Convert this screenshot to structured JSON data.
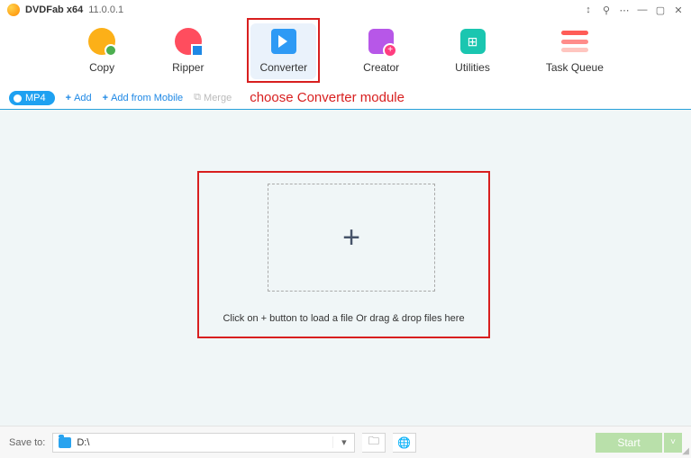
{
  "app": {
    "title": "DVDFab x64",
    "version": "11.0.0.1"
  },
  "modules": [
    {
      "key": "copy",
      "label": "Copy"
    },
    {
      "key": "ripper",
      "label": "Ripper"
    },
    {
      "key": "converter",
      "label": "Converter",
      "selected": true
    },
    {
      "key": "creator",
      "label": "Creator"
    },
    {
      "key": "utilities",
      "label": "Utilities"
    },
    {
      "key": "taskqueue",
      "label": "Task Queue"
    }
  ],
  "toolbar": {
    "format_pill": "MP4",
    "add_label": "Add",
    "add_mobile_label": "Add from Mobile",
    "merge_label": "Merge"
  },
  "annotation": {
    "text": "choose Converter module"
  },
  "drop": {
    "hint": "Click on + button to load a file Or drag & drop files here",
    "plus": "+"
  },
  "footer": {
    "save_to_label": "Save to:",
    "path": "D:\\",
    "start_label": "Start"
  }
}
